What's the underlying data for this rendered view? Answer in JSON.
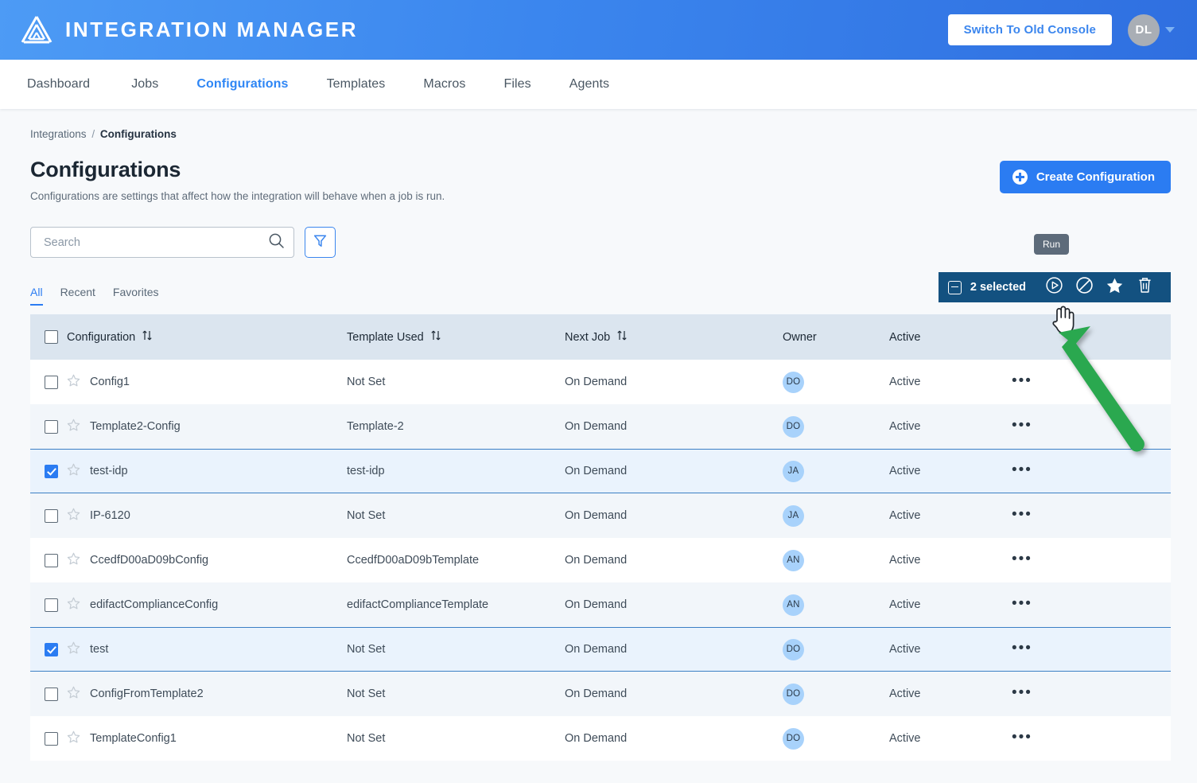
{
  "header": {
    "brand_title": "INTEGRATION MANAGER",
    "logo_icon": "triangle-layers-logo",
    "switch_console_label": "Switch To Old Console",
    "avatar_initials": "DL",
    "caret_icon": "chevron-down-icon",
    "brand_gradient_from": "#4d9bf5",
    "brand_gradient_to": "#2f6fe0"
  },
  "nav": {
    "items": [
      {
        "label": "Dashboard",
        "active": false
      },
      {
        "label": "Jobs",
        "active": false
      },
      {
        "label": "Configurations",
        "active": true
      },
      {
        "label": "Templates",
        "active": false
      },
      {
        "label": "Macros",
        "active": false
      },
      {
        "label": "Files",
        "active": false
      },
      {
        "label": "Agents",
        "active": false
      }
    ],
    "active_color": "#2e86f5"
  },
  "breadcrumb": {
    "root": "Integrations",
    "separator": "/",
    "current": "Configurations"
  },
  "page": {
    "title": "Configurations",
    "subtitle": "Configurations are settings that affect how the integration will behave when a job is run.",
    "create_button": "Create Configuration",
    "create_icon": "plus-circle-icon",
    "accent_color": "#2b7cf2"
  },
  "search": {
    "placeholder": "Search",
    "value": "",
    "search_icon": "search-icon",
    "filter_icon": "filter-funnel-icon"
  },
  "tabs": [
    {
      "label": "All",
      "active": true
    },
    {
      "label": "Recent",
      "active": false
    },
    {
      "label": "Favorites",
      "active": false
    }
  ],
  "bulk_bar": {
    "count_label": "2 selected",
    "deselect_icon": "minus-square-icon",
    "background": "#135180",
    "actions": [
      {
        "name": "run",
        "icon": "play-circle-icon",
        "tooltip": "Run"
      },
      {
        "name": "disable",
        "icon": "ban-circle-icon"
      },
      {
        "name": "favorite",
        "icon": "star-filled-icon"
      },
      {
        "name": "delete",
        "icon": "trash-icon"
      }
    ],
    "visible_tooltip": "Run"
  },
  "table": {
    "header_background": "#dbe5ef",
    "select_all_checked": false,
    "columns": [
      {
        "label": "Configuration",
        "sortable": true,
        "sort_icon": "sort-updown-icon"
      },
      {
        "label": "Template Used",
        "sortable": true,
        "sort_icon": "sort-updown-icon"
      },
      {
        "label": "Next Job",
        "sortable": true,
        "sort_icon": "sort-updown-icon"
      },
      {
        "label": "Owner",
        "sortable": false
      },
      {
        "label": "Active",
        "sortable": false
      }
    ],
    "rows": [
      {
        "checked": false,
        "favorite": false,
        "configuration": "Config1",
        "template_used": "Not Set",
        "next_job": "On Demand",
        "owner": "DO",
        "active": "Active",
        "menu": "•••",
        "stripe": "plain"
      },
      {
        "checked": false,
        "favorite": false,
        "configuration": "Template2-Config",
        "template_used": "Template-2",
        "next_job": "On Demand",
        "owner": "DO",
        "active": "Active",
        "menu": "•••",
        "stripe": "alt"
      },
      {
        "checked": true,
        "favorite": false,
        "configuration": "test-idp",
        "template_used": "test-idp",
        "next_job": "On Demand",
        "owner": "JA",
        "active": "Active",
        "menu": "•••",
        "stripe": "selected"
      },
      {
        "checked": false,
        "favorite": false,
        "configuration": "IP-6120",
        "template_used": "Not Set",
        "next_job": "On Demand",
        "owner": "JA",
        "active": "Active",
        "menu": "•••",
        "stripe": "alt"
      },
      {
        "checked": false,
        "favorite": false,
        "configuration": "CcedfD00aD09bConfig",
        "template_used": "CcedfD00aD09bTemplate",
        "next_job": "On Demand",
        "owner": "AN",
        "active": "Active",
        "menu": "•••",
        "stripe": "plain"
      },
      {
        "checked": false,
        "favorite": false,
        "configuration": "edifactComplianceConfig",
        "template_used": "edifactComplianceTemplate",
        "next_job": "On Demand",
        "owner": "AN",
        "active": "Active",
        "menu": "•••",
        "stripe": "alt"
      },
      {
        "checked": true,
        "favorite": false,
        "configuration": "test",
        "template_used": "Not Set",
        "next_job": "On Demand",
        "owner": "DO",
        "active": "Active",
        "menu": "•••",
        "stripe": "selected"
      },
      {
        "checked": false,
        "favorite": false,
        "configuration": "ConfigFromTemplate2",
        "template_used": "Not Set",
        "next_job": "On Demand",
        "owner": "DO",
        "active": "Active",
        "menu": "•••",
        "stripe": "alt"
      },
      {
        "checked": false,
        "favorite": false,
        "configuration": "TemplateConfig1",
        "template_used": "Not Set",
        "next_job": "On Demand",
        "owner": "DO",
        "active": "Active",
        "menu": "•••",
        "stripe": "plain"
      }
    ]
  },
  "annotations": {
    "cursor_icon": "pointing-hand-cursor",
    "arrow_icon": "green-arrow-annotation",
    "arrow_color": "#2aa84f"
  }
}
